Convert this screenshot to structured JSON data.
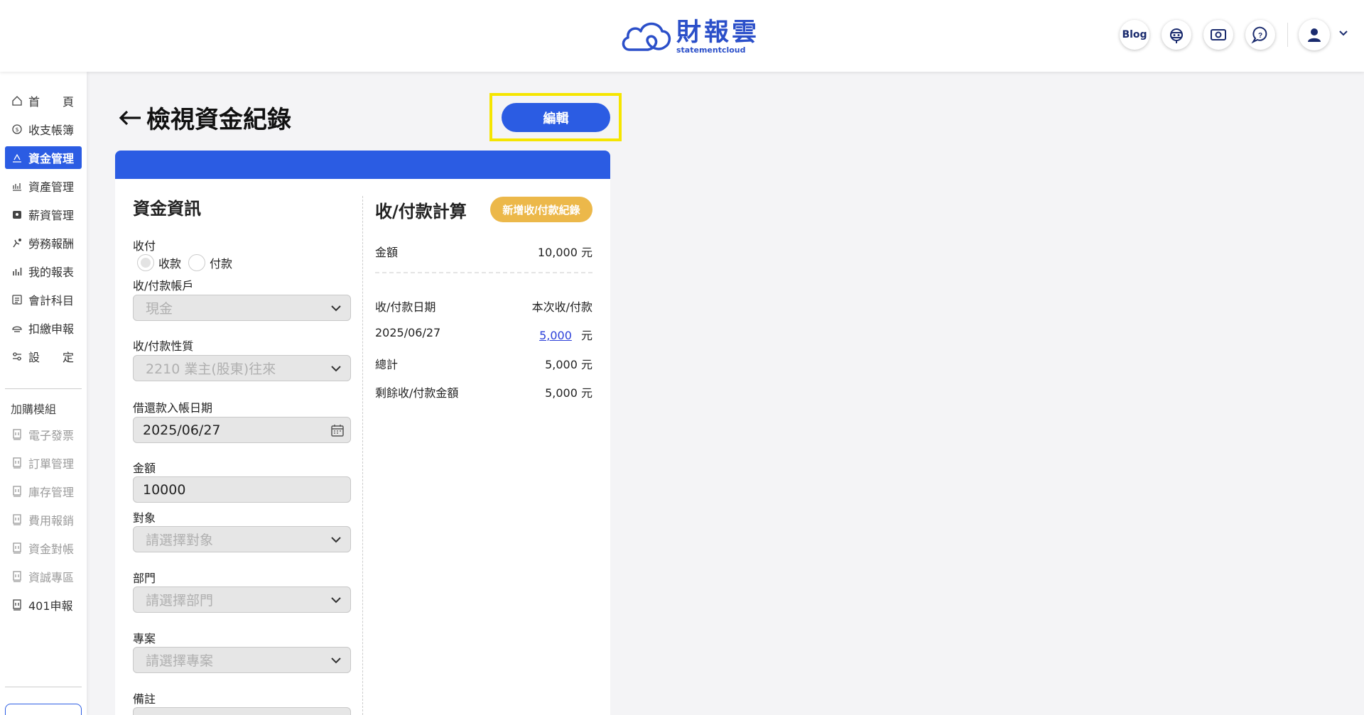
{
  "header": {
    "logo_zh": "財報雲",
    "logo_en": "statementcloud",
    "blog_label": "Blog",
    "icons": [
      "robot-icon",
      "money-icon",
      "help-chat-icon",
      "user-icon",
      "chevron-down-icon"
    ]
  },
  "sidebar": {
    "items": [
      {
        "label": "首　　頁",
        "icon": "home-icon"
      },
      {
        "label": "收支帳簿",
        "icon": "ledger-icon"
      },
      {
        "label": "資金管理",
        "icon": "funds-icon",
        "active": true
      },
      {
        "label": "資產管理",
        "icon": "assets-icon"
      },
      {
        "label": "薪資管理",
        "icon": "salary-icon"
      },
      {
        "label": "勞務報酬",
        "icon": "labor-icon"
      },
      {
        "label": "我的報表",
        "icon": "report-icon"
      },
      {
        "label": "會計科目",
        "icon": "accounts-icon"
      },
      {
        "label": "扣繳申報",
        "icon": "withholding-icon"
      },
      {
        "label": "設　　定",
        "icon": "settings-icon"
      }
    ],
    "addon_heading": "加購模組",
    "addons": [
      {
        "label": "電子發票"
      },
      {
        "label": "訂單管理"
      },
      {
        "label": "庫存管理"
      },
      {
        "label": "費用報銷"
      },
      {
        "label": "資金對帳"
      },
      {
        "label": "資誠專區"
      },
      {
        "label": "401申報"
      }
    ]
  },
  "page": {
    "title": "檢視資金紀錄",
    "edit_label": "編輯"
  },
  "info": {
    "title": "資金資訊",
    "type_label": "收付",
    "option_receive": "收款",
    "option_pay": "付款",
    "account_label": "收/付款帳戶",
    "account_value": "現金",
    "nature_label": "收/付款性質",
    "nature_value": "2210 業主(股東)往來",
    "date_label": "借還款入帳日期",
    "date_value": "2025/06/27",
    "amount_label": "金額",
    "amount_value": "10000",
    "target_label": "對象",
    "target_placeholder": "請選擇對象",
    "dept_label": "部門",
    "dept_placeholder": "請選擇部門",
    "project_label": "專案",
    "project_placeholder": "請選擇專案",
    "note_label": "備註"
  },
  "calc": {
    "title": "收/付款計算",
    "add_label": "新增收/付款紀錄",
    "amount_label": "金額",
    "amount_value": "10,000 元",
    "date_header": "收/付款日期",
    "current_header": "本次收/付款",
    "row_date": "2025/06/27",
    "row_amount": "5,000",
    "unit": "元",
    "total_label": "總計",
    "total_value": "5,000 元",
    "remain_label": "剩餘收/付款金額",
    "remain_value": "5,000 元"
  }
}
